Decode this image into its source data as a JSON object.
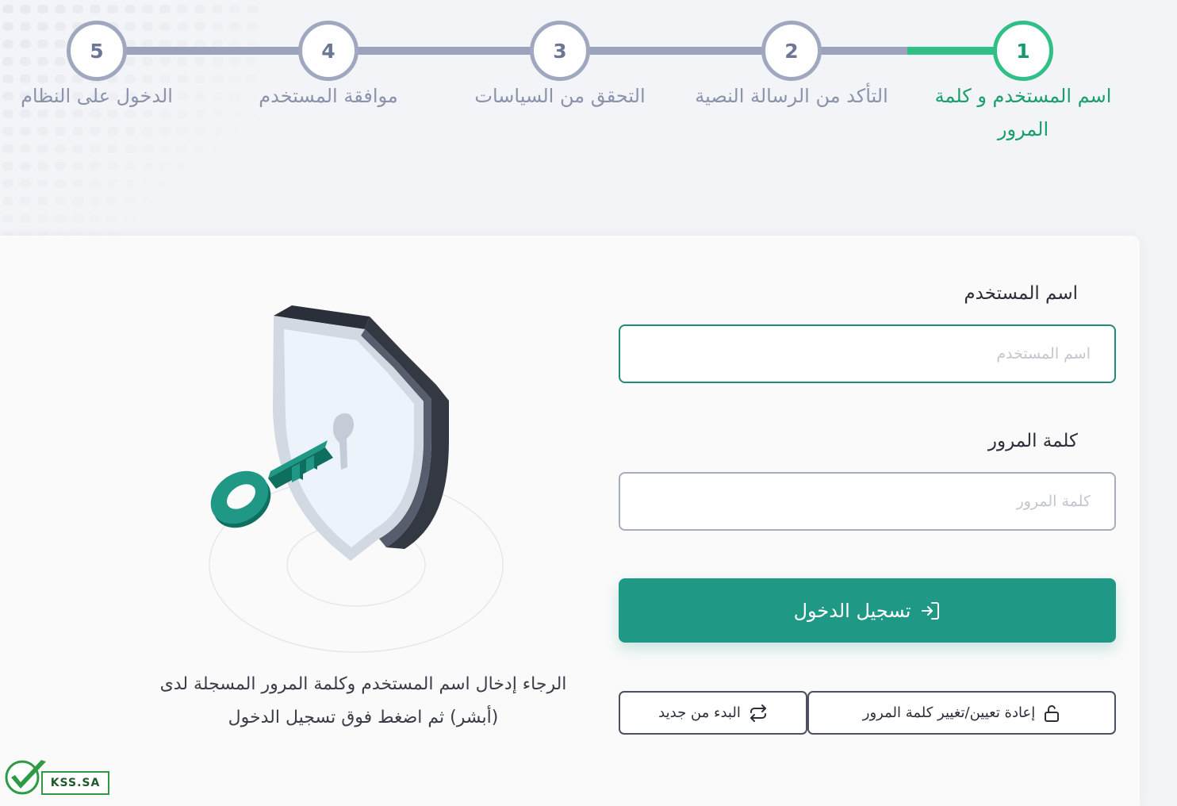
{
  "stepper": {
    "steps": [
      {
        "number": "1",
        "label": "اسم المستخدم و كلمة المرور",
        "active": true
      },
      {
        "number": "2",
        "label": "التأكد من الرسالة النصية",
        "active": false
      },
      {
        "number": "3",
        "label": "التحقق من السياسات",
        "active": false
      },
      {
        "number": "4",
        "label": "موافقة المستخدم",
        "active": false
      },
      {
        "number": "5",
        "label": "الدخول على النظام",
        "active": false
      }
    ]
  },
  "form": {
    "username_label": "اسم المستخدم",
    "username_placeholder": "اسم المستخدم",
    "username_value": "",
    "password_label": "كلمة المرور",
    "password_placeholder": "كلمة المرور",
    "password_value": "",
    "login_button": "تسجيل الدخول",
    "reset_password_button": "إعادة تعيين/تغيير كلمة المرور",
    "restart_button": "البدء من جديد"
  },
  "instructions": "الرجاء إدخال اسم المستخدم وكلمة المرور المسجلة لدى (أبشر) ثم اضغط فوق تسجيل الدخول",
  "watermark": {
    "text": "KSS.SA"
  },
  "colors": {
    "primary": "#1f9886",
    "active_step": "#2fbf87",
    "inactive_step": "#a0a8bf",
    "background": "#f3f4f7"
  },
  "icons": {
    "login": "login-arrow-icon",
    "reset": "unlock-icon",
    "restart": "repeat-icon",
    "illustration": "shield-key-illustration"
  }
}
